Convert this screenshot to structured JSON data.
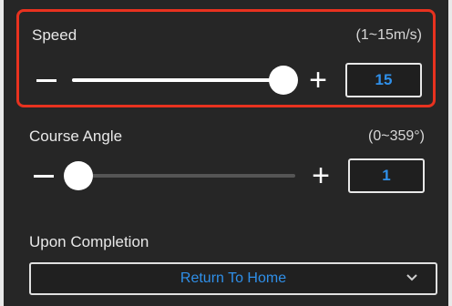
{
  "speed": {
    "label": "Speed",
    "range": "(1~15m/s)",
    "value": "15",
    "min": 1,
    "max": 15,
    "current": 15,
    "minus_icon": "minus-icon",
    "plus_icon": "plus-icon"
  },
  "course": {
    "label": "Course Angle",
    "range": "(0~359°)",
    "value": "1",
    "min": 0,
    "max": 359,
    "current": 1,
    "minus_icon": "minus-icon",
    "plus_icon": "plus-icon"
  },
  "completion": {
    "label": "Upon Completion",
    "selected": "Return To Home",
    "icon": "chevron-down-icon"
  },
  "colors": {
    "highlight": "#e8321f",
    "accent": "#2f8fe8",
    "background": "#262626"
  }
}
